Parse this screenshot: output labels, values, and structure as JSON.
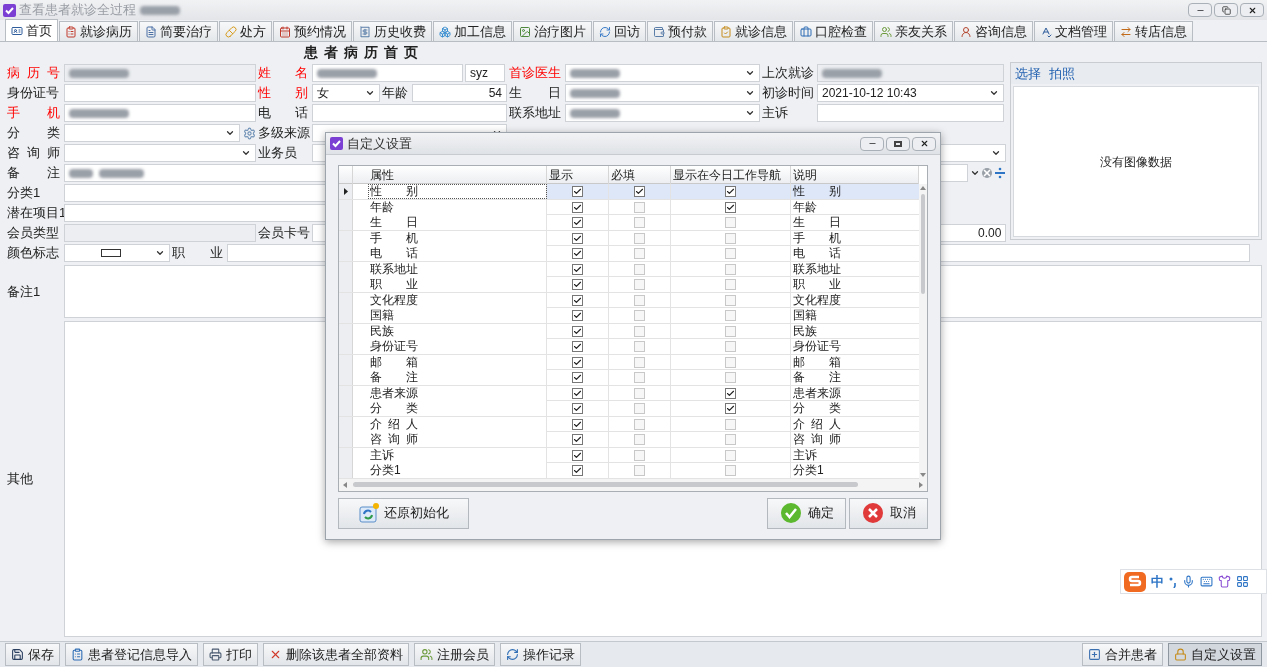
{
  "window": {
    "title": "查看患者就诊全过程",
    "title_redacted": true
  },
  "tabs": [
    {
      "label": "首页",
      "selected": true
    },
    {
      "label": "就诊病历",
      "selected": false
    },
    {
      "label": "简要治疗",
      "selected": false
    },
    {
      "label": "处方",
      "selected": false
    },
    {
      "label": "预约情况",
      "selected": false
    },
    {
      "label": "历史收费",
      "selected": false
    },
    {
      "label": "加工信息",
      "selected": false
    },
    {
      "label": "治疗图片",
      "selected": false
    },
    {
      "label": "回访",
      "selected": false
    },
    {
      "label": "预付款",
      "selected": false
    },
    {
      "label": "就诊信息",
      "selected": false
    },
    {
      "label": "口腔检查",
      "selected": false
    },
    {
      "label": "亲友关系",
      "selected": false
    },
    {
      "label": "咨询信息",
      "selected": false
    },
    {
      "label": "文档管理",
      "selected": false
    },
    {
      "label": "转店信息",
      "selected": false
    }
  ],
  "page_title": "患 者 病 历 首 页",
  "form": {
    "rows": [
      [
        {
          "label": "病 历 号",
          "required": true,
          "fields": [
            {
              "kind": "field",
              "redacted": true,
              "readonly": true
            }
          ]
        },
        {
          "label": "姓 名",
          "required": true,
          "fields": [
            {
              "kind": "field",
              "redacted": true,
              "readonly": false
            },
            {
              "kind": "field",
              "value": "syz",
              "readonly": false
            }
          ]
        },
        {
          "label": "首诊医生",
          "required": true,
          "fields": [
            {
              "kind": "select",
              "redacted": true
            }
          ]
        },
        {
          "label": "上次就诊",
          "required": false,
          "fields": [
            {
              "kind": "field",
              "redacted": true,
              "readonly": true
            }
          ]
        }
      ],
      [
        {
          "label": "身份证号",
          "required": false,
          "fields": [
            {
              "kind": "field",
              "readonly": false
            }
          ]
        },
        {
          "label": "性 别",
          "required": true,
          "fields": [
            {
              "kind": "select",
              "value": "女"
            },
            {
              "kind": "label",
              "text": "年龄"
            },
            {
              "kind": "number-field",
              "value": "54"
            }
          ]
        },
        {
          "label": "生 日",
          "required": false,
          "fields": [
            {
              "kind": "select",
              "redacted": true
            }
          ]
        },
        {
          "label": "初诊时间",
          "required": false,
          "fields": [
            {
              "kind": "select",
              "value": "2021-10-12 10:43"
            }
          ]
        }
      ],
      [
        {
          "label": "手 机",
          "required": true,
          "fields": [
            {
              "kind": "field",
              "redacted": true,
              "readonly": false
            }
          ]
        },
        {
          "label": "电 话",
          "required": false,
          "fields": [
            {
              "kind": "field",
              "readonly": false
            }
          ]
        },
        {
          "label": "联系地址",
          "required": false,
          "fields": [
            {
              "kind": "select",
              "redacted": true
            }
          ]
        },
        {
          "label": "主诉",
          "required": false,
          "fields": [
            {
              "kind": "field",
              "readonly": false
            }
          ]
        }
      ],
      [
        {
          "label": "分 类",
          "required": false,
          "fields": [
            {
              "kind": "select-gear"
            }
          ]
        },
        {
          "label": "多级来源",
          "required": false,
          "fields": [
            {
              "kind": "select"
            }
          ]
        }
      ],
      [
        {
          "label": "咨 询 师",
          "required": false,
          "fields": [
            {
              "kind": "select"
            }
          ]
        },
        {
          "label": "业务员",
          "required": false,
          "fields": [
            {
              "kind": "field",
              "readonly": false
            }
          ]
        },
        {
          "fields": [
            {
              "kind": "select"
            }
          ]
        }
      ],
      [
        {
          "label": "备 注",
          "required": false,
          "fields": [
            {
              "kind": "field-clear",
              "redacted": true
            }
          ]
        }
      ],
      [
        {
          "label": "分类1",
          "required": false,
          "fields": [
            {
              "kind": "field",
              "readonly": false
            }
          ]
        }
      ],
      [
        {
          "label": "潜在项目1",
          "required": false,
          "fields": [
            {
              "kind": "field",
              "readonly": false
            }
          ]
        }
      ],
      [
        {
          "label": "会员类型",
          "required": false,
          "fields": [
            {
              "kind": "field",
              "readonly": true
            }
          ]
        },
        {
          "label": "会员卡号",
          "required": false,
          "fields": [
            {
              "kind": "field",
              "readonly": false
            }
          ]
        },
        {
          "fields": [
            {
              "kind": "number-field",
              "value": "0.00"
            }
          ]
        }
      ],
      [
        {
          "label": "颜色标志",
          "required": false,
          "fields": [
            {
              "kind": "color-select"
            }
          ]
        },
        {
          "label": "职 业",
          "required": false,
          "fields": [
            {
              "kind": "field",
              "readonly": false
            }
          ]
        }
      ]
    ]
  },
  "image_panel": {
    "links": [
      "选择",
      "拍照"
    ],
    "empty_text": "没有图像数据"
  },
  "notes_field": {
    "label": "备注1"
  },
  "other_field": {
    "label": "其他"
  },
  "toolbar": {
    "left": [
      {
        "label": "保存",
        "pressed": false
      },
      {
        "label": "患者登记信息导入",
        "pressed": false
      },
      {
        "label": "打印",
        "pressed": false
      },
      {
        "label": "删除该患者全部资料",
        "pressed": false
      },
      {
        "label": "注册会员",
        "pressed": false
      },
      {
        "label": "操作记录",
        "pressed": false
      }
    ],
    "right": [
      {
        "label": "合并患者",
        "pressed": false
      },
      {
        "label": "自定义设置",
        "pressed": true
      }
    ]
  },
  "dialog": {
    "title": "自定义设置",
    "columns": [
      "属性",
      "显示",
      "必填",
      "显示在今日工作导航",
      "说明"
    ],
    "rows": [
      {
        "attribute": "性 别",
        "show": true,
        "required": true,
        "nav": true,
        "description": "性 别",
        "selected": true
      },
      {
        "attribute": "年龄",
        "show": true,
        "required": false,
        "nav": true,
        "description": "年龄",
        "selected": false
      },
      {
        "attribute": "生 日",
        "show": true,
        "required": false,
        "nav": false,
        "description": "生 日",
        "selected": false
      },
      {
        "attribute": "手 机",
        "show": true,
        "required": false,
        "nav": false,
        "description": "手 机",
        "selected": false
      },
      {
        "attribute": "电 话",
        "show": true,
        "required": false,
        "nav": false,
        "description": "电 话",
        "selected": false
      },
      {
        "attribute": "联系地址",
        "show": true,
        "required": false,
        "nav": false,
        "description": "联系地址",
        "selected": false
      },
      {
        "attribute": "职 业",
        "show": true,
        "required": false,
        "nav": false,
        "description": "职 业",
        "selected": false
      },
      {
        "attribute": "文化程度",
        "show": true,
        "required": false,
        "nav": false,
        "description": "文化程度",
        "selected": false
      },
      {
        "attribute": "国籍",
        "show": true,
        "required": false,
        "nav": false,
        "description": "国籍",
        "selected": false
      },
      {
        "attribute": "民族",
        "show": true,
        "required": false,
        "nav": false,
        "description": "民族",
        "selected": false
      },
      {
        "attribute": "身份证号",
        "show": true,
        "required": false,
        "nav": false,
        "description": "身份证号",
        "selected": false
      },
      {
        "attribute": "邮 箱",
        "show": true,
        "required": false,
        "nav": false,
        "description": "邮 箱",
        "selected": false
      },
      {
        "attribute": "备 注",
        "show": true,
        "required": false,
        "nav": false,
        "description": "备 注",
        "selected": false
      },
      {
        "attribute": "患者来源",
        "show": true,
        "required": false,
        "nav": true,
        "description": "患者来源",
        "selected": false
      },
      {
        "attribute": "分 类",
        "show": true,
        "required": false,
        "nav": true,
        "description": "分 类",
        "selected": false
      },
      {
        "attribute": "介 绍 人",
        "show": true,
        "required": false,
        "nav": false,
        "description": "介 绍 人",
        "selected": false
      },
      {
        "attribute": "咨 询 师",
        "show": true,
        "required": false,
        "nav": false,
        "description": "咨 询 师",
        "selected": false
      },
      {
        "attribute": "主诉",
        "show": true,
        "required": false,
        "nav": false,
        "description": "主诉",
        "selected": false
      },
      {
        "attribute": "分类1",
        "show": true,
        "required": false,
        "nav": false,
        "description": "分类1",
        "selected": false
      }
    ],
    "buttons": {
      "reset": "还原初始化",
      "ok": "确定",
      "cancel": "取消"
    }
  },
  "ime": {
    "label": "中"
  }
}
